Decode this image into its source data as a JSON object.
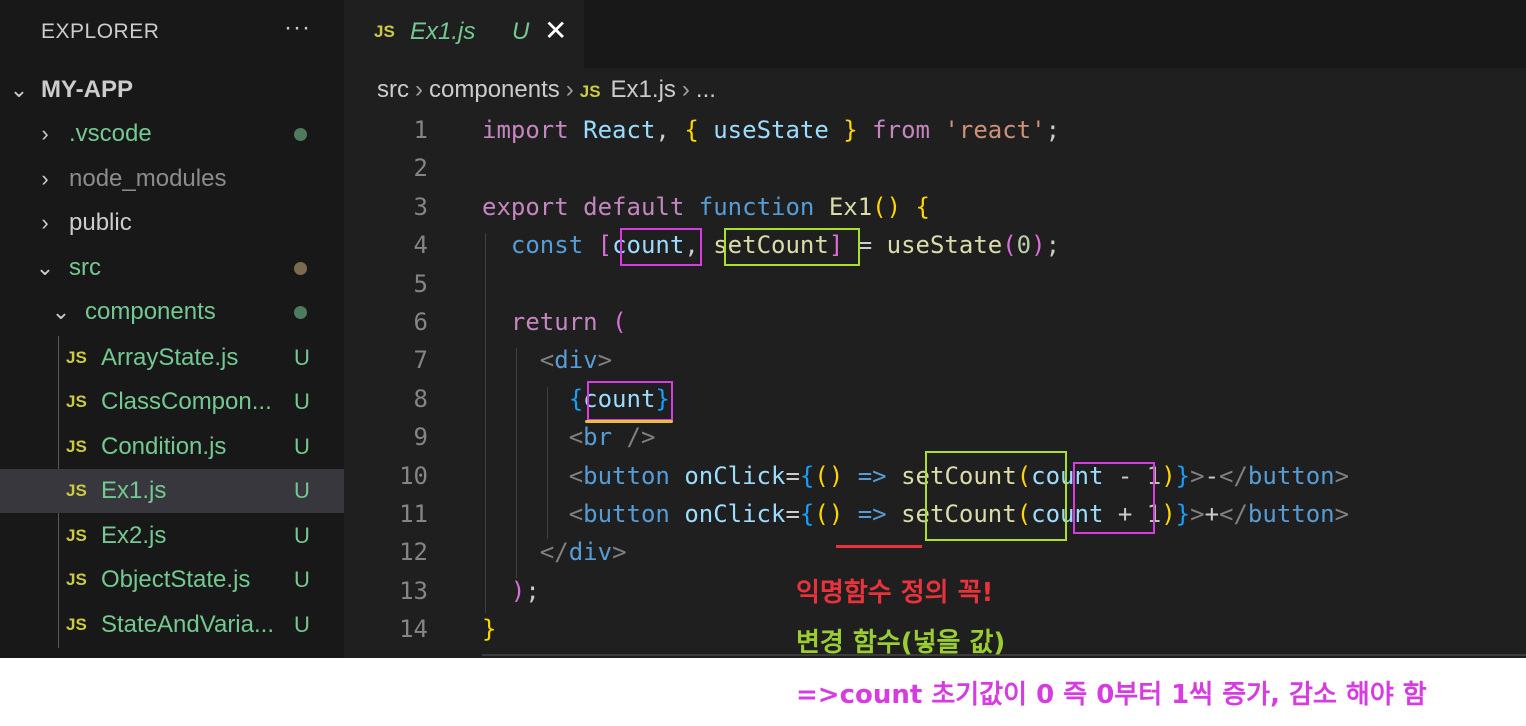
{
  "sidebar": {
    "title": "EXPLORER",
    "more": "···",
    "root": "MY-APP",
    "items": [
      {
        "label": ".vscode",
        "color": "#73c991"
      },
      {
        "label": "node_modules",
        "color": "#8c8c8c"
      },
      {
        "label": "public",
        "color": "#cccccc"
      },
      {
        "label": "src",
        "color": "#73c991"
      },
      {
        "label": "components",
        "color": "#73c991"
      },
      {
        "label": "ArrayState.js",
        "badge": "U"
      },
      {
        "label": "ClassCompon...",
        "badge": "U"
      },
      {
        "label": "Condition.js",
        "badge": "U"
      },
      {
        "label": "Ex1.js",
        "badge": "U"
      },
      {
        "label": "Ex2.js",
        "badge": "U"
      },
      {
        "label": "ObjectState.js",
        "badge": "U"
      },
      {
        "label": "StateAndVaria...",
        "badge": "U"
      }
    ],
    "js_icon": "JS"
  },
  "tab": {
    "icon": "JS",
    "name": "Ex1.js",
    "status": "U",
    "close": "✕"
  },
  "breadcrumb": {
    "parts": [
      "src",
      "components",
      "Ex1.js",
      "..."
    ],
    "sep": "›"
  },
  "code": {
    "line_numbers": [
      "1",
      "2",
      "3",
      "4",
      "5",
      "6",
      "7",
      "8",
      "9",
      "10",
      "11",
      "12",
      "13",
      "14"
    ]
  },
  "annotations": {
    "red": "익명함수 정의 꼭!",
    "green": "변경 함수(넣을 값)",
    "magenta": "=>count 초기값이 0 즉 0부터 1씩 증가, 감소 해야 함"
  },
  "colors": {
    "sidebar_bg": "#181818",
    "editor_bg": "#1f1f1f",
    "untracked": "#73c991",
    "box_magenta": "#d63ce0",
    "box_green": "#a8e02c",
    "annotation_red": "#e8323c"
  }
}
